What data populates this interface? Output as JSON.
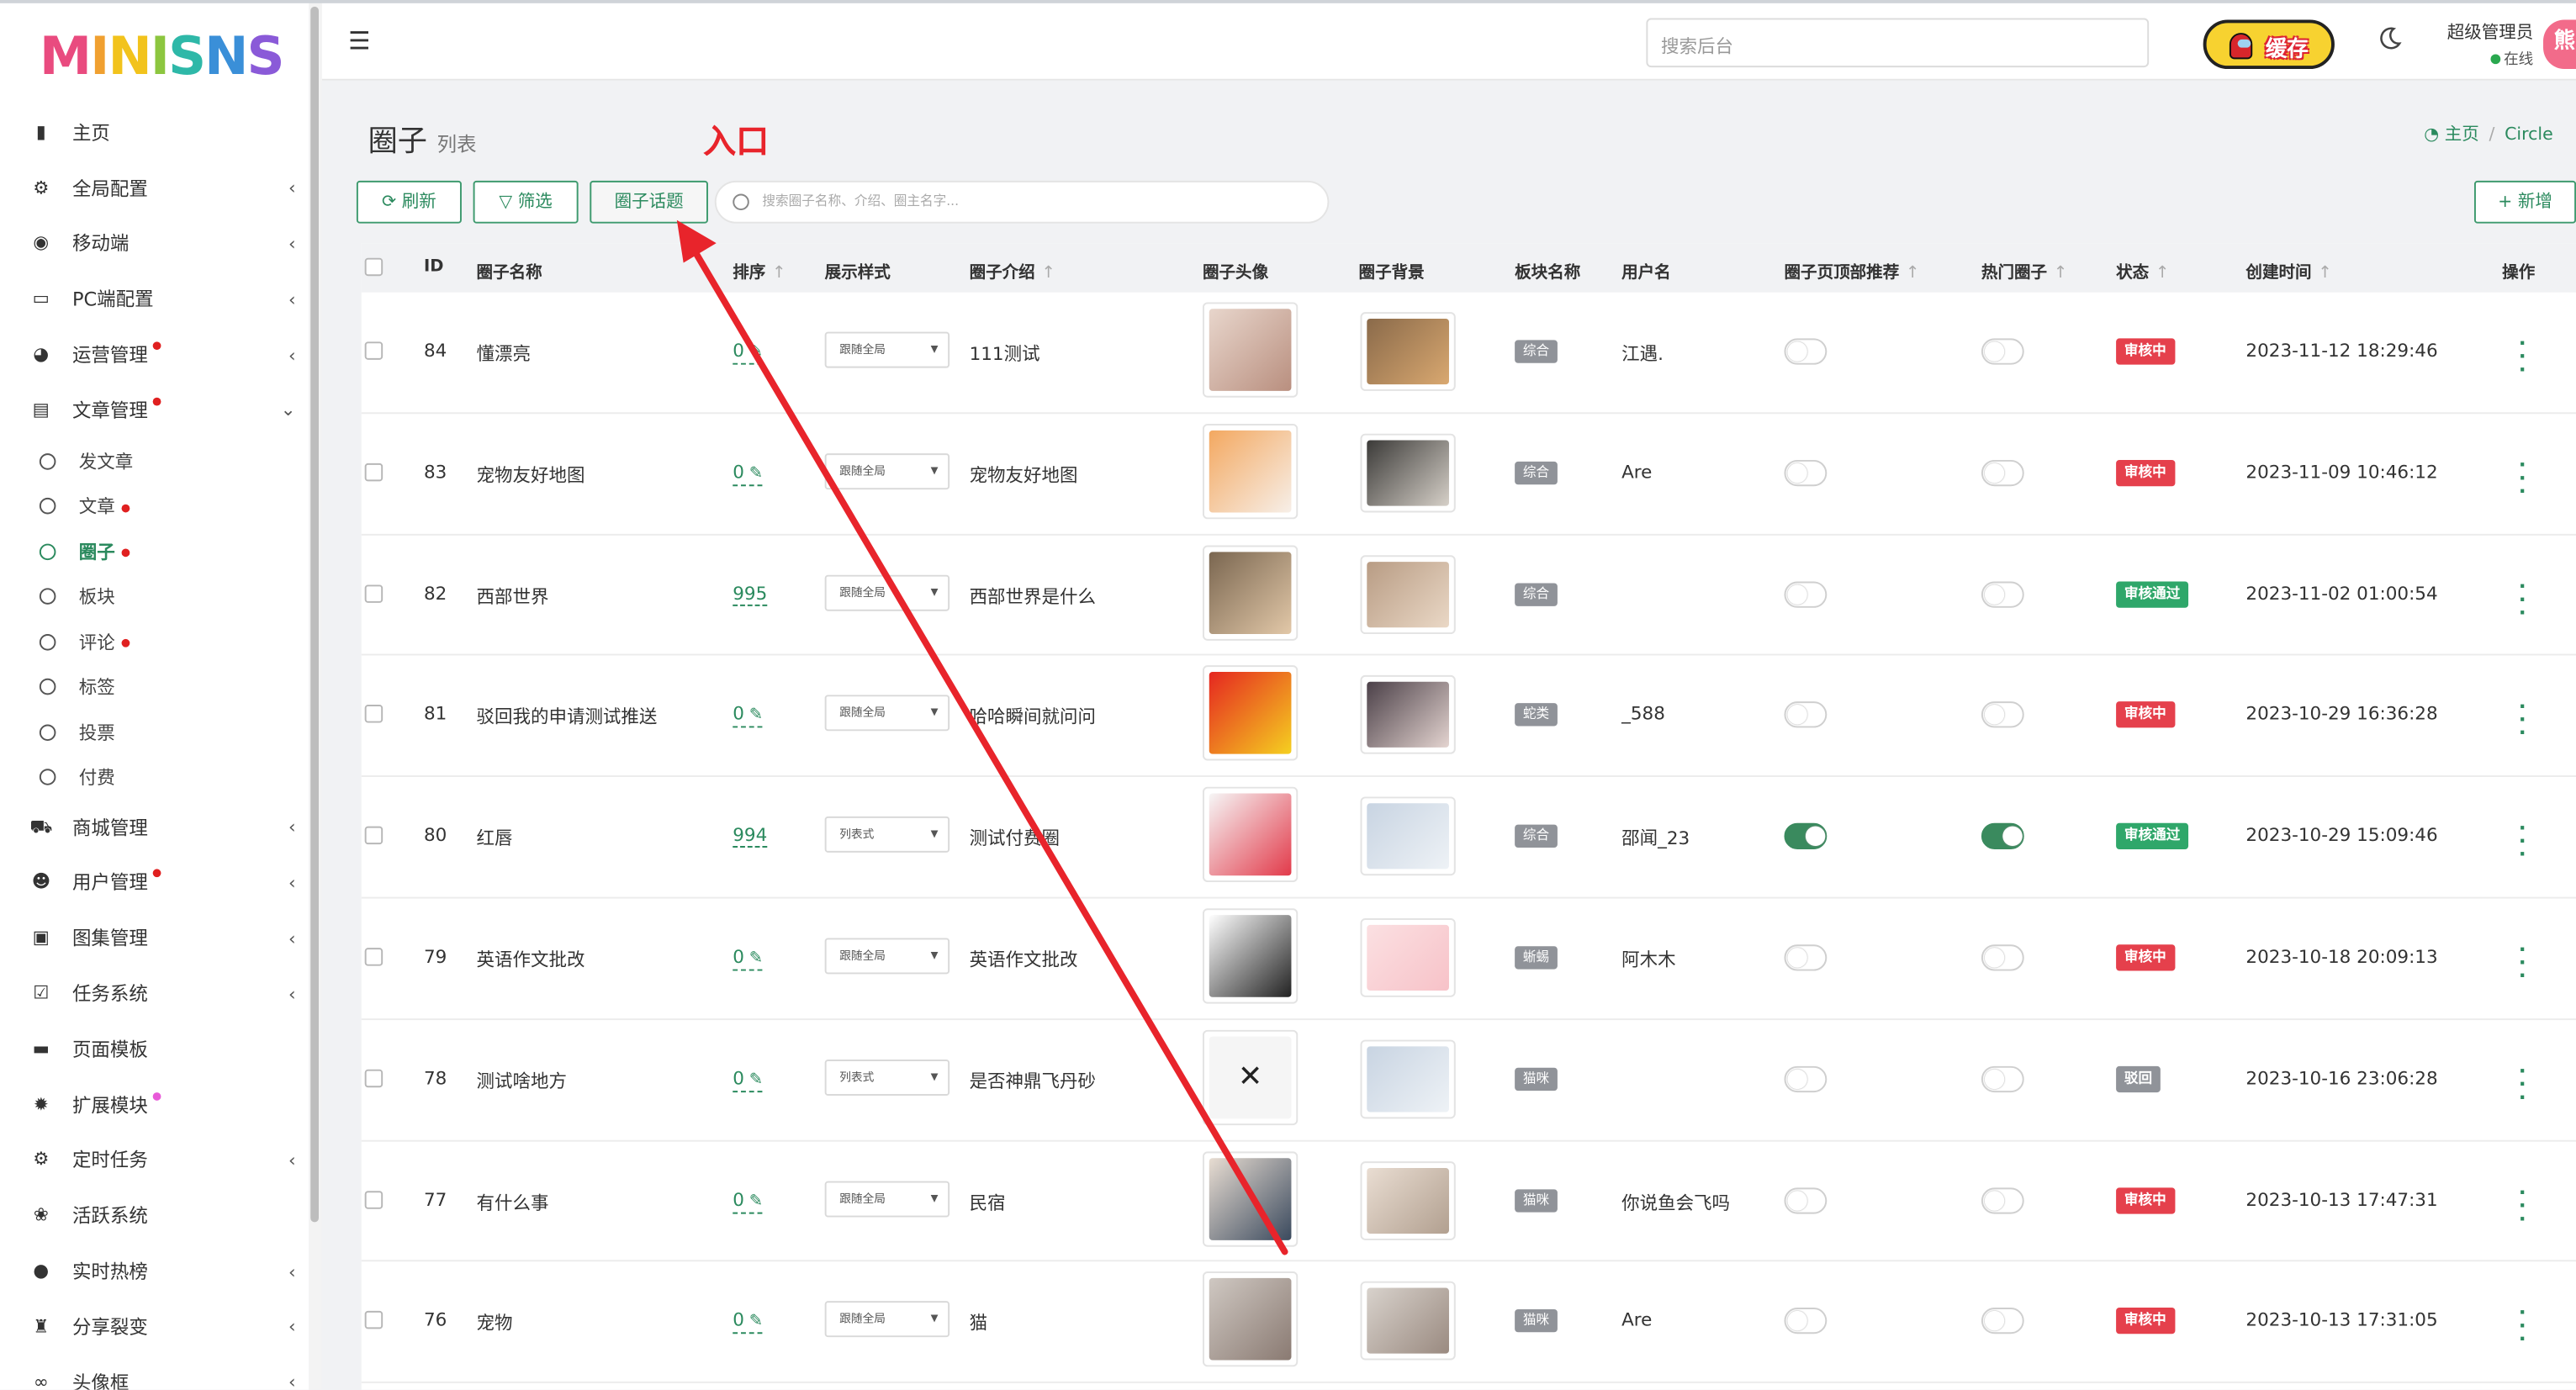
{
  "logo": [
    "M",
    "I",
    "N",
    "I",
    "S",
    "N",
    "S"
  ],
  "header": {
    "search_placeholder": "搜索后台",
    "cache_label": "缓存",
    "admin_name": "超级管理员",
    "admin_status": "在线",
    "avatar_text": "熊"
  },
  "sidebar": {
    "items": [
      {
        "label": "主页",
        "icon": "chart-bar-icon",
        "chev": false,
        "dot": false
      },
      {
        "label": "全局配置",
        "icon": "gear-icon",
        "chev": true,
        "dot": false
      },
      {
        "label": "移动端",
        "icon": "wechat-icon",
        "chev": true,
        "dot": false
      },
      {
        "label": "PC端配置",
        "icon": "desktop-icon",
        "chev": true,
        "dot": false
      },
      {
        "label": "运营管理",
        "icon": "pie-chart-icon",
        "chev": true,
        "dot": true
      },
      {
        "label": "文章管理",
        "icon": "book-icon",
        "chev": true,
        "dot": true,
        "open": true
      }
    ],
    "subitems": [
      {
        "label": "发文章",
        "dot": false,
        "active": false
      },
      {
        "label": "文章",
        "dot": true,
        "active": false
      },
      {
        "label": "圈子",
        "dot": true,
        "active": true
      },
      {
        "label": "板块",
        "dot": false,
        "active": false
      },
      {
        "label": "评论",
        "dot": true,
        "active": false
      },
      {
        "label": "标签",
        "dot": false,
        "active": false
      },
      {
        "label": "投票",
        "dot": false,
        "active": false
      },
      {
        "label": "付费",
        "dot": false,
        "active": false
      }
    ],
    "items2": [
      {
        "label": "商城管理",
        "icon": "cart-icon",
        "chev": true,
        "dot": false
      },
      {
        "label": "用户管理",
        "icon": "users-icon",
        "chev": true,
        "dot": true
      },
      {
        "label": "图集管理",
        "icon": "image-icon",
        "chev": true,
        "dot": false
      },
      {
        "label": "任务系统",
        "icon": "check-square-icon",
        "chev": true,
        "dot": false
      },
      {
        "label": "页面模板",
        "icon": "coffee-icon",
        "chev": false,
        "dot": false
      },
      {
        "label": "扩展模块",
        "icon": "puzzle-gear-icon",
        "chev": false,
        "dot": "pink"
      },
      {
        "label": "定时任务",
        "icon": "cogs-icon",
        "chev": true,
        "dot": false
      },
      {
        "label": "活跃系统",
        "icon": "paw-icon",
        "chev": false,
        "dot": false
      },
      {
        "label": "实时热榜",
        "icon": "bomb-icon",
        "chev": true,
        "dot": false
      },
      {
        "label": "分享裂变",
        "icon": "sitemap-icon",
        "chev": true,
        "dot": false
      },
      {
        "label": "头像框",
        "icon": "glasses-icon",
        "chev": true,
        "dot": false
      }
    ]
  },
  "page": {
    "title": "圈子",
    "subtitle": "列表",
    "annotation": "入口",
    "breadcrumb_home": "主页",
    "breadcrumb_sep": "/",
    "breadcrumb_current": "Circle"
  },
  "toolbar": {
    "refresh": "刷新",
    "filter": "筛选",
    "topic": "圈子话题",
    "search_placeholder": "搜索圈子名称、介绍、圈主名字...",
    "add": "新增"
  },
  "table": {
    "headers": {
      "id": "ID",
      "name": "圈子名称",
      "sort": "排序",
      "style": "展示样式",
      "intro": "圈子介绍",
      "avatar": "圈子头像",
      "bg": "圈子背景",
      "block": "板块名称",
      "user": "用户名",
      "top": "圈子页顶部推荐",
      "hot": "热门圈子",
      "status": "状态",
      "created": "创建时间",
      "ops": "操作"
    },
    "rows": [
      {
        "id": "84",
        "name": "懂漂亮",
        "sort": "0",
        "sort_edit": true,
        "style": "跟随全局",
        "intro": "111测试",
        "block": "综合",
        "user": "江遇.",
        "top": false,
        "hot": false,
        "status": "审核中",
        "status_kind": "rev",
        "created": "2023-11-12 18:29:46",
        "av": [
          "#e8d6cc",
          "#b98f7f"
        ],
        "bg": [
          "#8a6a4a",
          "#d9a870"
        ]
      },
      {
        "id": "83",
        "name": "宠物友好地图",
        "sort": "0",
        "sort_edit": true,
        "style": "跟随全局",
        "intro": "宠物友好地图",
        "block": "综合",
        "user": "Are",
        "top": false,
        "hot": false,
        "status": "审核中",
        "status_kind": "rev",
        "created": "2023-11-09 10:46:12",
        "av": [
          "#f3a860",
          "#f7efe8"
        ],
        "bg": [
          "#3b3a38",
          "#d6d0c8"
        ]
      },
      {
        "id": "82",
        "name": "西部世界",
        "sort": "995",
        "sort_edit": false,
        "style": "跟随全局",
        "intro": "西部世界是什么",
        "block": "综合",
        "user": "",
        "top": false,
        "hot": false,
        "status": "审核通过",
        "status_kind": "ok",
        "created": "2023-11-02 01:00:54",
        "av": [
          "#7a6650",
          "#e2c8a8"
        ],
        "bg": [
          "#b89c84",
          "#ead8c6"
        ]
      },
      {
        "id": "81",
        "name": "驳回我的申请测试推送",
        "sort": "0",
        "sort_edit": true,
        "style": "跟随全局",
        "intro": "哈哈瞬间就问问",
        "block": "蛇类",
        "user": "_588",
        "top": false,
        "hot": false,
        "status": "审核中",
        "status_kind": "rev",
        "created": "2023-10-29 16:36:28",
        "av": [
          "#e52620",
          "#f5d020"
        ],
        "bg": [
          "#4b4048",
          "#e4d4d0"
        ]
      },
      {
        "id": "80",
        "name": "红唇",
        "sort": "994",
        "sort_edit": false,
        "style": "列表式",
        "intro": "测试付费圈",
        "block": "综合",
        "user": "邵闻_23",
        "top": true,
        "hot": true,
        "status": "审核通过",
        "status_kind": "ok",
        "created": "2023-10-29 15:09:46",
        "av": [
          "#f6f6f6",
          "#e23a4a"
        ],
        "bg": [
          "#c8d4e2",
          "#eef2f6"
        ]
      },
      {
        "id": "79",
        "name": "英语作文批改",
        "sort": "0",
        "sort_edit": true,
        "style": "跟随全局",
        "intro": "英语作文批改",
        "block": "蜥蜴",
        "user": "阿木木",
        "top": false,
        "hot": false,
        "status": "审核中",
        "status_kind": "rev",
        "created": "2023-10-18 20:09:13",
        "av": [
          "#ffffff",
          "#222222"
        ],
        "bg": [
          "#fbe0e2",
          "#f7c2c8"
        ]
      },
      {
        "id": "78",
        "name": "测试啥地方",
        "sort": "0",
        "sort_edit": true,
        "style": "列表式",
        "intro": "是否神鼎飞丹砂",
        "block": "猫咪",
        "user": "",
        "top": false,
        "hot": false,
        "status": "驳回",
        "status_kind": "rej",
        "created": "2023-10-16 23:06:28",
        "av": [
          "#f5f5f5",
          "#f5f5f5"
        ],
        "bg": [
          "#c8d4e2",
          "#eef2f6"
        ],
        "av_x": "✕"
      },
      {
        "id": "77",
        "name": "有什么事",
        "sort": "0",
        "sort_edit": true,
        "style": "跟随全局",
        "intro": "民宿",
        "block": "猫咪",
        "user": "你说鱼会飞吗",
        "top": false,
        "hot": false,
        "status": "审核中",
        "status_kind": "rev",
        "created": "2023-10-13 17:47:31",
        "av": [
          "#e8ddd2",
          "#3b4a5e"
        ],
        "bg": [
          "#e9ddd2",
          "#b2a090"
        ]
      },
      {
        "id": "76",
        "name": "宠物",
        "sort": "0",
        "sort_edit": true,
        "style": "跟随全局",
        "intro": "猫",
        "block": "猫咪",
        "user": "Are",
        "top": false,
        "hot": false,
        "status": "审核中",
        "status_kind": "rev",
        "created": "2023-10-13 17:31:05",
        "av": [
          "#cfc8c2",
          "#8a7a72"
        ],
        "bg": [
          "#d8d2cc",
          "#9a8a80"
        ]
      }
    ]
  }
}
